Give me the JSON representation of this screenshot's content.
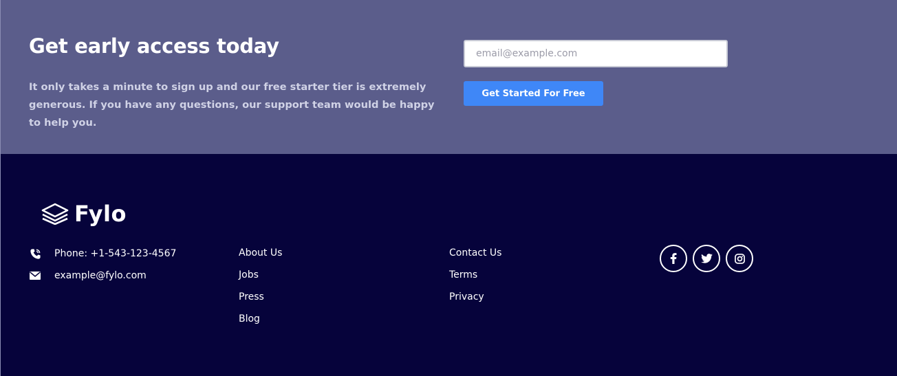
{
  "cta": {
    "title": "Get early access today",
    "description": "It only takes a minute to sign up and our free starter tier is extremely generous. If you have any questions, our support team would be happy to help you.",
    "email_placeholder": "email@example.com",
    "button_label": "Get Started For Free"
  },
  "footer": {
    "logo_text": "Fylo",
    "logo_icon": "stacked-layers-icon",
    "contact": {
      "phone": "Phone: +1-543-123-4567",
      "phone_icon": "phone-icon",
      "email": "example@fylo.com",
      "email_icon": "envelope-icon"
    },
    "links_col1": [
      "About Us",
      "Jobs",
      "Press",
      "Blog"
    ],
    "links_col2": [
      "Contact Us",
      "Terms",
      "Privacy"
    ],
    "social": [
      "facebook-icon",
      "twitter-icon",
      "instagram-icon"
    ]
  },
  "colors": {
    "cta_background": "#5b5d8b",
    "footer_background": "#06033b",
    "button_blue": "#3f87f7"
  }
}
